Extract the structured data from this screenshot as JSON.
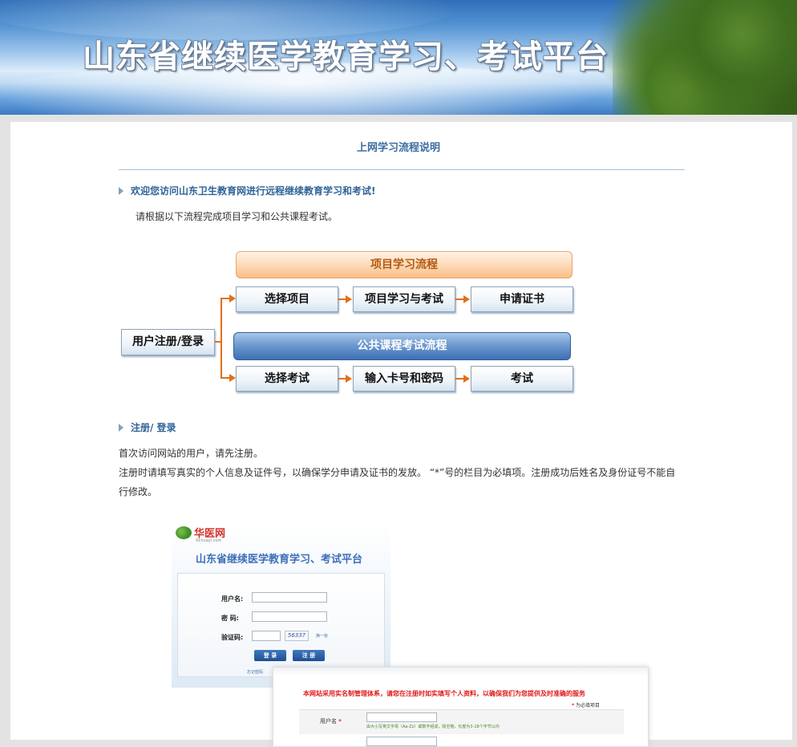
{
  "banner": {
    "title": "山东省继续医学教育学习、考试平台"
  },
  "page": {
    "title": "上网学习流程说明",
    "welcome": "欢迎您访问山东卫生教育网进行远程继续教育学习和考试!",
    "intro": "请根据以下流程完成项目学习和公共课程考试。"
  },
  "flow": {
    "start": "用户注册/登录",
    "project_header": "项目学习流程",
    "project_steps": [
      "选择项目",
      "项目学习与考试",
      "申请证书"
    ],
    "public_header": "公共课程考试流程",
    "public_steps": [
      "选择考试",
      "输入卡号和密码",
      "考试"
    ],
    "arrow_color": "#e36f17"
  },
  "register_section": {
    "heading": "注册/ 登录",
    "line1": "首次访问网站的用户，请先注册。",
    "line2": "注册时请填写真实的个人信息及证件号，以确保学分申请及证书的发放。 “*”号的栏目为必填项。注册成功后姓名及身份证号不能自",
    "line3": "行修改。"
  },
  "login_screenshot": {
    "logo_text": "华医网",
    "logo_sub": "91huayi.com",
    "title": "山东省继续医学教育学习、考试平台",
    "username_label": "用户名:",
    "password_label": "密  码:",
    "captcha_label": "验证码:",
    "captcha_value": "56337",
    "change_link": "换一张",
    "login_button": "登 录",
    "register_button": "注 册",
    "forgot_link": "忘记密码"
  },
  "register_screenshot": {
    "notice": "本网站采用实名制管理体系，请您在注册时如实填写个人资料，以确保我们为您提供及时准确的服务",
    "required_star": "*",
    "required_text": " 为必填项目",
    "username_label": "用户名",
    "username_star": "*",
    "username_hint": "由大小写英文字母（Aa-Zz）或数字组成，除空格，长度为3-18个字节以内"
  }
}
